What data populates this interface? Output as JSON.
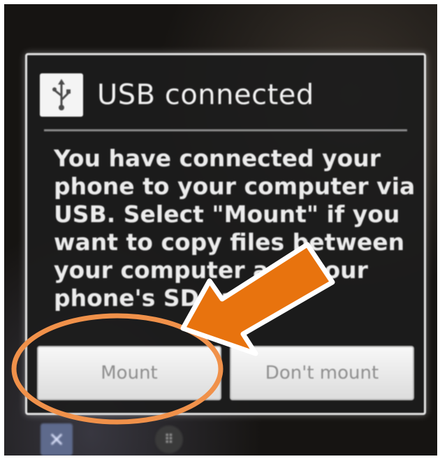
{
  "dialog": {
    "title": "USB connected",
    "icon": "usb-icon",
    "message": "You have connected your phone to your computer via USB. Select \"Mount\" if you want to copy files between your computer and your phone's SD card.",
    "buttons": {
      "mount_label": "Mount",
      "dont_mount_label": "Don't mount"
    }
  },
  "home_screen": {
    "left_icon": "app-icon",
    "center_icon": "launcher-icon"
  },
  "annotation": {
    "arrow_color": "#e8730e",
    "circle_color": "#f0914a",
    "target": "mount-button"
  }
}
